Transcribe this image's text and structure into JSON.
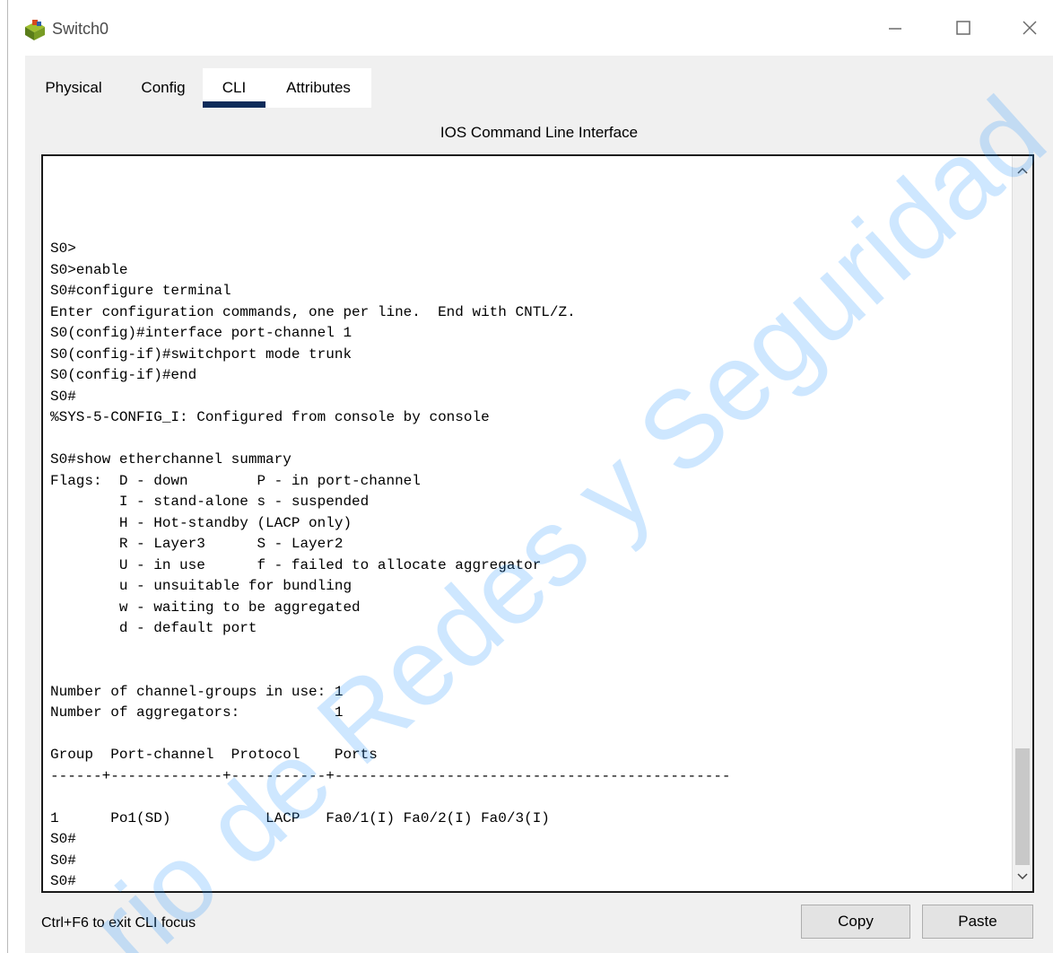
{
  "window": {
    "title": "Switch0",
    "icons": {
      "app": "switch-device-icon",
      "minimize": "minimize-icon",
      "maximize": "maximize-icon",
      "close": "close-icon"
    }
  },
  "tabs": [
    {
      "label": "Physical",
      "active": false
    },
    {
      "label": "Config",
      "active": false
    },
    {
      "label": "CLI",
      "active": true
    },
    {
      "label": "Attributes",
      "active": false
    }
  ],
  "cli": {
    "title": "IOS Command Line Interface",
    "output": "S0>\nS0>enable\nS0#configure terminal\nEnter configuration commands, one per line.  End with CNTL/Z.\nS0(config)#interface port-channel 1\nS0(config-if)#switchport mode trunk\nS0(config-if)#end\nS0#\n%SYS-5-CONFIG_I: Configured from console by console\n\nS0#show etherchannel summary\nFlags:  D - down        P - in port-channel\n        I - stand-alone s - suspended\n        H - Hot-standby (LACP only)\n        R - Layer3      S - Layer2\n        U - in use      f - failed to allocate aggregator\n        u - unsuitable for bundling\n        w - waiting to be aggregated\n        d - default port\n\n\nNumber of channel-groups in use: 1\nNumber of aggregators:           1\n\nGroup  Port-channel  Protocol    Ports\n------+-------------+-----------+----------------------------------------------\n\n1      Po1(SD)           LACP   Fa0/1(I) Fa0/2(I) Fa0/3(I)\nS0#\nS0#\nS0#",
    "scroll_icons": {
      "up": "chevron-up-icon",
      "down": "chevron-down-icon"
    }
  },
  "footer": {
    "hint": "Ctrl+F6 to exit CLI focus",
    "copy_label": "Copy",
    "paste_label": "Paste"
  },
  "watermark": {
    "text": "rio de Redes y Seguridad -",
    "color": "#1e90ff"
  }
}
